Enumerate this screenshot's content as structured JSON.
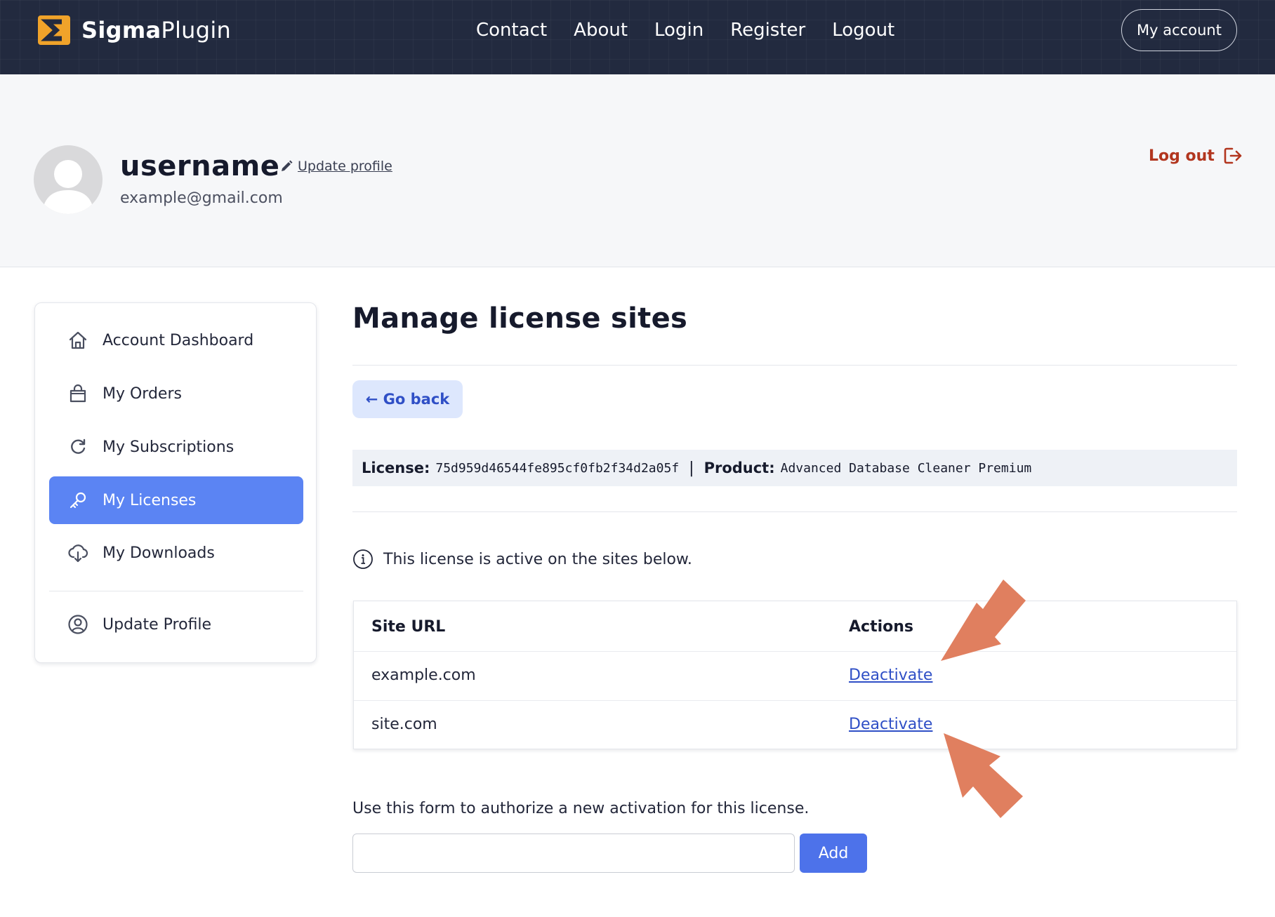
{
  "brand": {
    "name_bold": "Sigma",
    "name_light": "Plugin",
    "accent": "#f0a32a"
  },
  "nav": {
    "items": [
      "Contact",
      "About",
      "Login",
      "Register",
      "Logout"
    ],
    "account_button": "My account"
  },
  "profile": {
    "username": "username",
    "email": "example@gmail.com",
    "update_link": "Update profile",
    "logout": "Log out"
  },
  "sidebar": {
    "items": [
      {
        "label": "Account Dashboard",
        "icon": "home-icon"
      },
      {
        "label": "My Orders",
        "icon": "bag-icon"
      },
      {
        "label": "My Subscriptions",
        "icon": "refresh-icon"
      },
      {
        "label": "My Licenses",
        "icon": "key-icon",
        "active": true
      },
      {
        "label": "My Downloads",
        "icon": "cloud-download-icon"
      },
      {
        "label": "Update Profile",
        "icon": "user-circle-icon"
      }
    ]
  },
  "main": {
    "title": "Manage license sites",
    "go_back": "← Go back",
    "license": {
      "license_label": "License:",
      "license_key": "75d959d46544fe895cf0fb2f34d2a05f",
      "separator": "|",
      "product_label": "Product:",
      "product_name": "Advanced Database Cleaner Premium"
    },
    "info": "This license is active on the sites below.",
    "table": {
      "headers": [
        "Site URL",
        "Actions"
      ],
      "rows": [
        {
          "site": "example.com",
          "action": "Deactivate"
        },
        {
          "site": "site.com",
          "action": "Deactivate"
        }
      ]
    },
    "form": {
      "help": "Use this form to authorize a new activation for this license.",
      "input_value": "",
      "add_button": "Add"
    }
  },
  "colors": {
    "topbar": "#222a3f",
    "active_item": "#5b84f3",
    "link": "#2f4fc6",
    "logout": "#b2361f",
    "annotation_arrow": "#e07f5f"
  }
}
